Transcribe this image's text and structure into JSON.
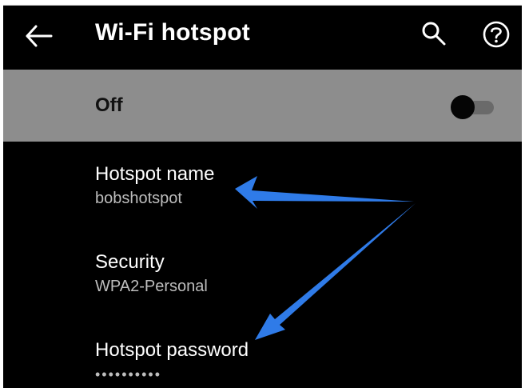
{
  "appbar": {
    "title": "Wi-Fi hotspot",
    "back_icon": "arrow-back-icon",
    "search_icon": "search-icon",
    "help_icon": "help-circle-icon"
  },
  "master_switch": {
    "label": "Off",
    "state": "off"
  },
  "settings": [
    {
      "title": "Hotspot name",
      "value": "bobshotspot"
    },
    {
      "title": "Security",
      "value": "WPA2-Personal"
    },
    {
      "title": "Hotspot password",
      "value": "••••••••••"
    }
  ],
  "colors": {
    "background": "#000000",
    "master_bar": "#8d8d8d",
    "annotation_arrow": "#2f7be8",
    "subtitle_text": "#bdbdbd"
  }
}
